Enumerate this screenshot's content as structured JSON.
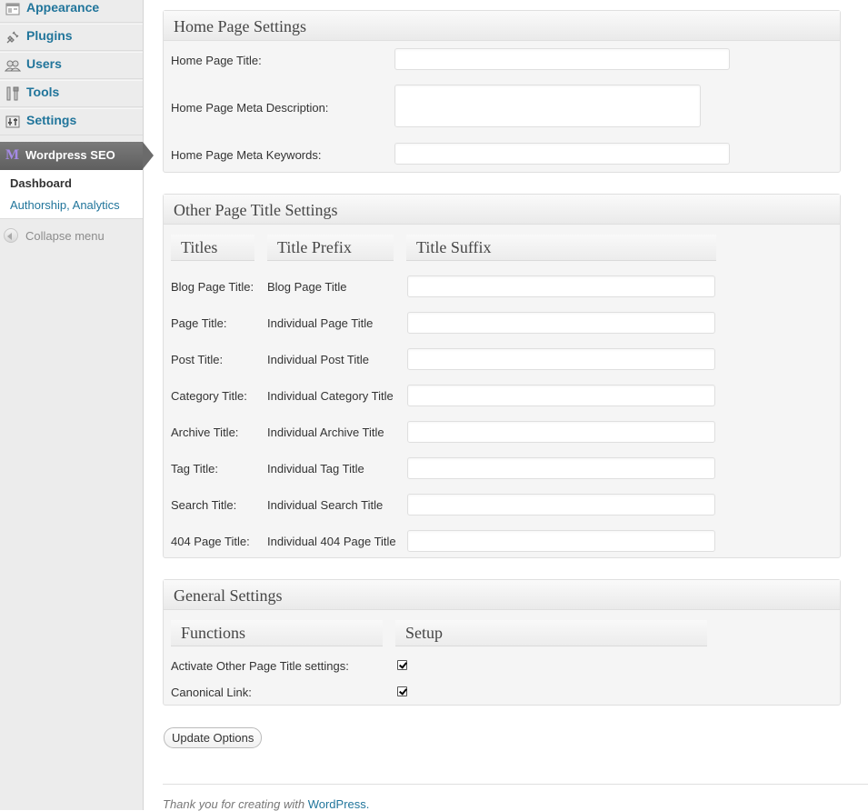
{
  "sidebar": {
    "items": [
      {
        "label": "Appearance",
        "icon": "appearance-icon"
      },
      {
        "label": "Plugins",
        "icon": "plugins-icon"
      },
      {
        "label": "Users",
        "icon": "users-icon"
      },
      {
        "label": "Tools",
        "icon": "tools-icon"
      },
      {
        "label": "Settings",
        "icon": "settings-icon"
      }
    ],
    "active": {
      "label": "Wordpress SEO",
      "logo": "M"
    },
    "submenu": [
      "Dashboard",
      "Authorship, Analytics"
    ],
    "collapse": "Collapse menu"
  },
  "home_panel": {
    "title": "Home Page Settings",
    "fields": [
      {
        "label": "Home Page Title:",
        "value": ""
      },
      {
        "label": "Home Page Meta Description:",
        "value": ""
      },
      {
        "label": "Home Page Meta Keywords:",
        "value": ""
      }
    ]
  },
  "other_panel": {
    "title": "Other Page Title Settings",
    "columns": [
      "Titles",
      "Title Prefix",
      "Title Suffix"
    ],
    "rows": [
      {
        "title": "Blog Page Title:",
        "prefix": "Blog Page Title",
        "suffix": ""
      },
      {
        "title": "Page Title:",
        "prefix": "Individual Page Title",
        "suffix": ""
      },
      {
        "title": "Post Title:",
        "prefix": "Individual Post Title",
        "suffix": ""
      },
      {
        "title": "Category Title:",
        "prefix": "Individual Category Title",
        "suffix": ""
      },
      {
        "title": "Archive Title:",
        "prefix": "Individual Archive Title",
        "suffix": ""
      },
      {
        "title": "Tag Title:",
        "prefix": "Individual Tag Title",
        "suffix": ""
      },
      {
        "title": "Search Title:",
        "prefix": "Individual Search Title",
        "suffix": ""
      },
      {
        "title": "404 Page Title:",
        "prefix": "Individual 404 Page Title",
        "suffix": ""
      }
    ]
  },
  "general_panel": {
    "title": "General Settings",
    "columns": [
      "Functions",
      "Setup"
    ],
    "options": [
      {
        "label": "Activate Other Page Title settings:",
        "checked": true
      },
      {
        "label": "Canonical Link:",
        "checked": true
      }
    ]
  },
  "update_button": "Update Options",
  "footer": {
    "text": "Thank you for creating with ",
    "link": "WordPress."
  },
  "colors": {
    "link": "#21759b",
    "active_menu": "#6b6b6b",
    "panel_bg": "#f5f5f5"
  }
}
